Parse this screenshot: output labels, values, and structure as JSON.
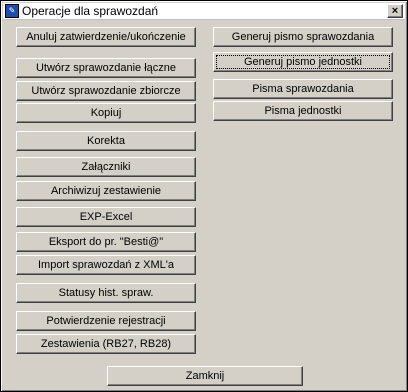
{
  "window": {
    "title": "Operacje dla sprawozdań",
    "icon": "app-icon",
    "close_label": "×"
  },
  "left_buttons": [
    "Anuluj zatwierdzenie/ukończenie",
    "Utwórz sprawozdanie łączne",
    "Utwórz sprawozdanie zbiorcze",
    "Kopiuj",
    "Korekta",
    "Załączniki",
    "Archiwizuj zestawienie",
    "EXP-Excel",
    "Eksport do pr. \"Besti@\"",
    "Import sprawozdań z XML'a",
    "Statusy hist. spraw.",
    "Potwierdzenie rejestracji",
    "Zestawienia (RB27, RB28)"
  ],
  "right_buttons": [
    "Generuj pismo sprawozdania",
    "Generuj pismo jednostki",
    "Pisma sprawozdania",
    "Pisma jednostki"
  ],
  "footer": {
    "close_label": "Zamknij"
  }
}
